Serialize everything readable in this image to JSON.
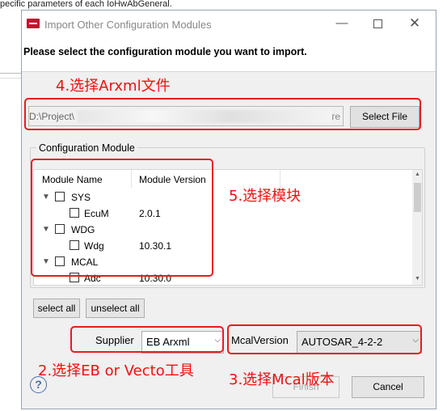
{
  "background": {
    "top_text": "pecific parameters of each IoHwAbGeneral."
  },
  "window": {
    "title": "Import Other Configuration Modules",
    "minimize": "—",
    "close": "✕"
  },
  "instruction": "Please select the configuration module you want to import.",
  "file_path": {
    "value": "D:\\Project\\",
    "tail": "re",
    "button": "Select File"
  },
  "module_group": {
    "legend": "Configuration Module",
    "columns": [
      "Module Name",
      "Module Version"
    ],
    "rows": [
      {
        "name": "SYS",
        "version": "",
        "level": 0,
        "expanded": true
      },
      {
        "name": "EcuM",
        "version": "2.0.1",
        "level": 1
      },
      {
        "name": "WDG",
        "version": "",
        "level": 0,
        "expanded": true
      },
      {
        "name": "Wdg",
        "version": "10.30.1",
        "level": 1
      },
      {
        "name": "MCAL",
        "version": "",
        "level": 0,
        "expanded": true
      },
      {
        "name": "Adc",
        "version": "10.30.0",
        "level": 1
      }
    ]
  },
  "buttons": {
    "select_all": "select all",
    "unselect_all": "unselect all",
    "finish": "Finish",
    "cancel": "Cancel"
  },
  "supplier": {
    "label": "Supplier",
    "value": "EB Arxml"
  },
  "mcal_version": {
    "label": "McalVersion",
    "value": "AUTOSAR_4-2-2"
  },
  "annotations": {
    "step2": "2.选择EB or Vecto工具",
    "step3": "3.选择Mcal版本",
    "step4": "4.选择Arxml文件",
    "step5": "5.选择模块"
  },
  "colors": {
    "annotation_red": "#e81c1c",
    "app_icon": "#c8102e",
    "help_icon": "#4a6ea9"
  }
}
